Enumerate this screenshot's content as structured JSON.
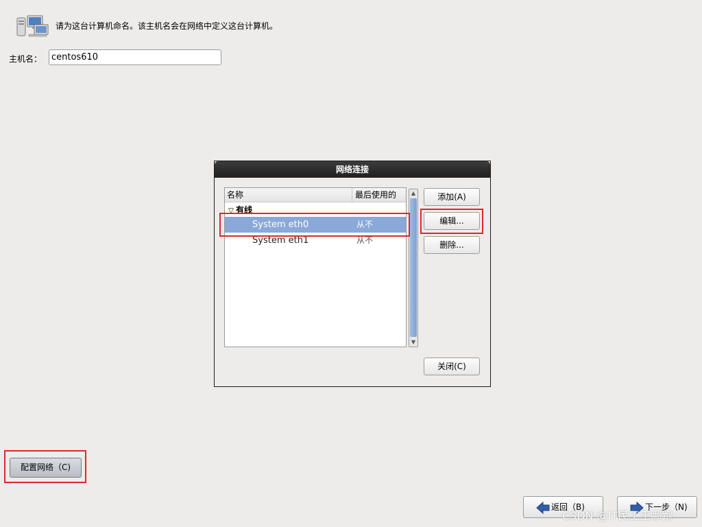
{
  "header": {
    "icon": "computers-network-icon",
    "text": "请为这台计算机命名。该主机名会在网络中定义这台计算机。"
  },
  "hostname": {
    "label": "主机名：",
    "value": "centos610"
  },
  "dialog": {
    "title": "网络连接",
    "columns": [
      "名称",
      "最后使用的"
    ],
    "group": "有线",
    "connections": [
      {
        "name": "System eth0",
        "last_used": "从不",
        "selected": true
      },
      {
        "name": "System eth1",
        "last_used": "从不",
        "selected": false
      }
    ],
    "buttons": {
      "add": "添加(A)",
      "edit": "编辑...",
      "delete": "删除...",
      "close": "关闭(C)"
    }
  },
  "config_network_button": "配置网络（C)",
  "nav": {
    "back": "返回（B)",
    "next": "下一步（N)"
  },
  "watermark": "CSDN @IT民工王哪跑",
  "colors": {
    "selection": "#8aa8d8",
    "highlight_box": "#e0262b",
    "titlebar": "#2a2a2a"
  }
}
